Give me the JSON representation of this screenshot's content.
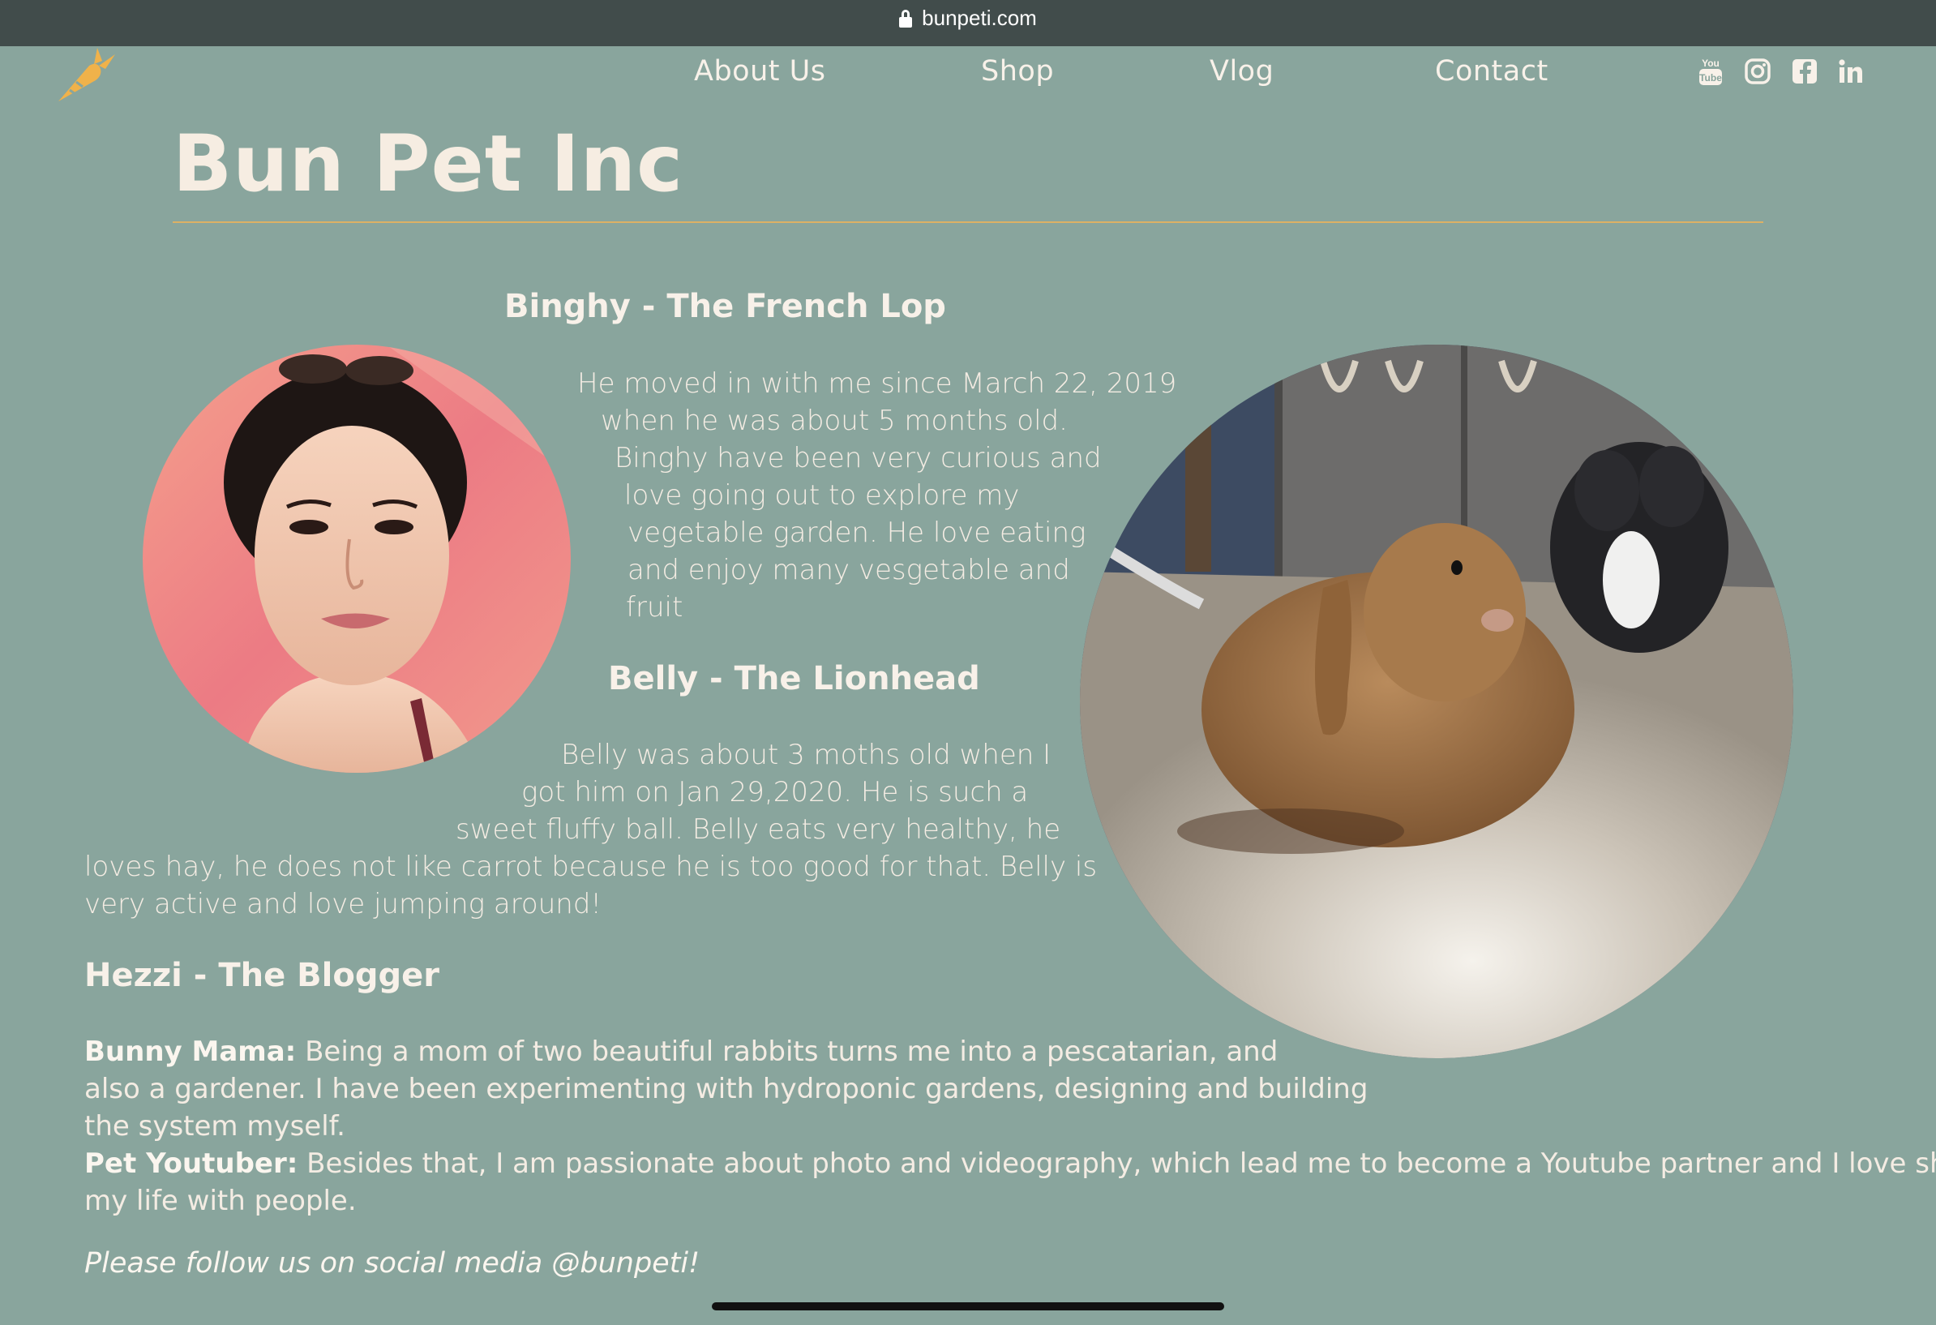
{
  "browser": {
    "url": "bunpeti.com"
  },
  "nav": {
    "items": [
      {
        "label": "About Us"
      },
      {
        "label": "Shop"
      },
      {
        "label": "Vlog"
      },
      {
        "label": "Contact"
      }
    ],
    "social_icons": [
      "youtube-icon",
      "instagram-icon",
      "facebook-icon",
      "linkedin-icon"
    ]
  },
  "logo": {
    "icon": "carrot-icon"
  },
  "site": {
    "title": "Bun Pet Inc"
  },
  "binghy": {
    "heading": "Binghy - The French Lop",
    "lines": [
      "He moved in with me since March 22, 2019",
      "when he was about 5 months old.",
      "Binghy have been very curious and",
      "love going out to explore my",
      "vegetable garden. He love eating",
      "and enjoy many vesgetable and",
      "fruit"
    ]
  },
  "belly": {
    "heading": "Belly - The Lionhead",
    "lines": [
      "Belly was about 3 moths old when I",
      "got him on Jan 29,2020. He is such a",
      "sweet fluffy ball. Belly eats very healthy, he",
      "loves hay, he does not like carrot because he is too good for that. Belly is",
      "very active and love jumping around!"
    ]
  },
  "hezzi": {
    "heading": "Hezzi - The Blogger",
    "mama_label": "Bunny Mama:",
    "mama_lines": [
      " Being a mom of two beautiful rabbits turns me into a pescatarian, and",
      "also a gardener. I have been experimenting with hydroponic gardens, designing and building",
      "the system myself."
    ],
    "youtuber_label": "Pet Youtuber:",
    "youtuber_lines": [
      " Besides that, I am passionate about photo and videography, which lead me to become a Youtube partner and I love sharing",
      "my life with people."
    ]
  },
  "footer": {
    "follow_text": "Please follow us on social media @bunpeti!"
  },
  "colors": {
    "background": "#89a59d",
    "browser_bar": "#414c4b",
    "accent_rule": "#dcb165",
    "logo": "#f0b24a",
    "text": "#f4ece3"
  }
}
